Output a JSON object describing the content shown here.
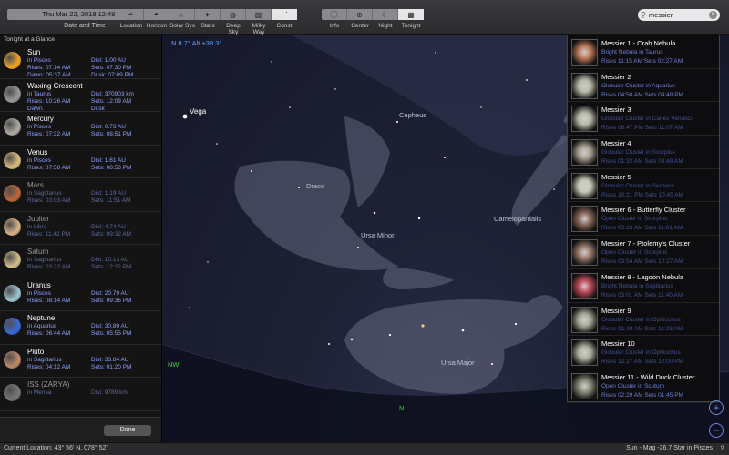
{
  "toolbar": {
    "date_value": "Thu Mar 22, 2018  12:48 PM",
    "date_label": "Date and Time",
    "view_buttons": [
      {
        "label": "Location",
        "icon": "location-pin-icon"
      },
      {
        "label": "Horizon",
        "icon": "horizon-icon"
      },
      {
        "label": "Solar Sys",
        "icon": "saturn-icon"
      },
      {
        "label": "Stars",
        "icon": "stars-icon"
      },
      {
        "label": "Deep Sky",
        "icon": "galaxy-icon"
      },
      {
        "label": "Milky Way",
        "icon": "milky-way-icon"
      },
      {
        "label": "Const",
        "icon": "constellation-icon"
      }
    ],
    "action_buttons": [
      {
        "label": "Info",
        "icon": "info-icon"
      },
      {
        "label": "Center",
        "icon": "target-icon"
      },
      {
        "label": "Night",
        "icon": "moon-icon"
      },
      {
        "label": "Tonight",
        "icon": "tonight-icon"
      }
    ],
    "search_value": "messier"
  },
  "left_panel": {
    "title": "Tonight at a Glance",
    "done_label": "Done",
    "items": [
      {
        "name": "Sun",
        "l1": "in Pisces",
        "l2": "Rises: 07:14 AM",
        "l3": "Dawn: 05:37 AM",
        "r1": "Dist: 1.00 AU",
        "r2": "Sets: 07:30 PM",
        "r3": "Dusk: 07:09 PM",
        "color": "#f5a623",
        "dim": false
      },
      {
        "name": "Waxing Crescent",
        "l1": "in Taurus",
        "l2": "Rises: 10:26 AM",
        "l3": "Dawn",
        "r1": "Dist: 370903 km",
        "r2": "Sets: 12:09 AM",
        "r3": "Dusk",
        "color": "#9a9a9a",
        "dim": false
      },
      {
        "name": "Mercury",
        "l1": "in Pisces",
        "l2": "Rises: 07:32 AM",
        "l3": "",
        "r1": "Dist: 0.73 AU",
        "r2": "Sets: 08:51 PM",
        "r3": "",
        "color": "#b0aca4",
        "dim": false
      },
      {
        "name": "Venus",
        "l1": "in Pisces",
        "l2": "Rises: 07:58 AM",
        "l3": "",
        "r1": "Dist: 1.61 AU",
        "r2": "Sets: 08:58 PM",
        "r3": "",
        "color": "#e0c080",
        "dim": false
      },
      {
        "name": "Mars",
        "l1": "in Sagittarius",
        "l2": "Rises: 03:03 AM",
        "l3": "",
        "r1": "Dist: 1.19 AU",
        "r2": "Sets: 11:51 AM",
        "r3": "",
        "color": "#c0653a",
        "dim": true
      },
      {
        "name": "Jupiter",
        "l1": "in Libra",
        "l2": "Rises: 11:42 PM",
        "l3": "",
        "r1": "Dist: 4.74 AU",
        "r2": "Sets: 09:32 AM",
        "r3": "",
        "color": "#d8b488",
        "dim": true
      },
      {
        "name": "Saturn",
        "l1": "in Sagittarius",
        "l2": "Rises: 03:22 AM",
        "l3": "",
        "r1": "Dist: 10.13 AU",
        "r2": "Sets: 12:22 PM",
        "r3": "",
        "color": "#d6c08a",
        "dim": true
      },
      {
        "name": "Uranus",
        "l1": "in Pisces",
        "l2": "Rises: 08:14 AM",
        "l3": "",
        "r1": "Dist: 20.79 AU",
        "r2": "Sets: 09:36 PM",
        "r3": "",
        "color": "#9ec6d0",
        "dim": false
      },
      {
        "name": "Neptune",
        "l1": "in Aquarius",
        "l2": "Rises: 06:44 AM",
        "l3": "",
        "r1": "Dist: 30.89 AU",
        "r2": "Sets: 05:55 PM",
        "r3": "",
        "color": "#3a6ad8",
        "dim": false
      },
      {
        "name": "Pluto",
        "l1": "in Sagittarius",
        "l2": "Rises: 04:12 AM",
        "l3": "",
        "r1": "Dist: 33.84 AU",
        "r2": "Sets: 01:20 PM",
        "r3": "",
        "color": "#c08a6a",
        "dim": false
      },
      {
        "name": "ISS (ZARYA)",
        "l1": "in Mensa",
        "l2": "",
        "l3": "",
        "r1": "Dist: 9789 km",
        "r2": "",
        "r3": "",
        "color": "#777777",
        "dim": true
      }
    ]
  },
  "sky": {
    "readout": "N 8.7° Alt +38.3°",
    "labels": [
      "Vega",
      "Cepheus",
      "Draco",
      "Ursa Minor",
      "Camelopardalis",
      "Ursa Major"
    ],
    "compass": [
      "NW",
      "N"
    ]
  },
  "results": [
    {
      "name": "Messier 1 - Crab Nebula",
      "type": "Bright Nebula in Taurus",
      "times": "Rises 11:15 AM  Sets 02:27 AM",
      "color": "#c07a5a",
      "dim": false
    },
    {
      "name": "Messier 2",
      "type": "Globular Cluster in Aquarius",
      "times": "Rises 04:50 AM  Sets 04:48 PM",
      "color": "#b8b8a8",
      "dim": false
    },
    {
      "name": "Messier 3",
      "type": "Globular Cluster in Canes Venatici",
      "times": "Rises 06:47 PM  Sets 11:07 AM",
      "color": "#b8b8a8",
      "dim": true
    },
    {
      "name": "Messier 4",
      "type": "Globular Cluster in Scorpius",
      "times": "Rises 01:32 AM  Sets 09:48 AM",
      "color": "#a8a090",
      "dim": true
    },
    {
      "name": "Messier 5",
      "type": "Globular Cluster in Serpens",
      "times": "Rises 10:21 PM  Sets 10:45 AM",
      "color": "#c8c8b8",
      "dim": true
    },
    {
      "name": "Messier 6 - Butterfly Cluster",
      "type": "Open Cluster in Scorpius",
      "times": "Rises 03:23 AM  Sets 11:01 AM",
      "color": "#8a6a5a",
      "dim": true
    },
    {
      "name": "Messier 7 - Ptolemy's Cluster",
      "type": "Open Cluster in Scorpius",
      "times": "Rises 03:54 AM  Sets 10:27 AM",
      "color": "#9a7a6a",
      "dim": true
    },
    {
      "name": "Messier 8 - Lagoon Nebula",
      "type": "Bright Nebula in Sagittarius",
      "times": "Rises 03:01 AM  Sets 11:40 AM",
      "color": "#c04a5a",
      "dim": true
    },
    {
      "name": "Messier 9",
      "type": "Globular Cluster in Ophiuchus",
      "times": "Rises 01:48 AM  Sets 11:23 AM",
      "color": "#a8a898",
      "dim": true
    },
    {
      "name": "Messier 10",
      "type": "Globular Cluster in Ophiuchus",
      "times": "Rises 12:27 AM  Sets 12:00 PM",
      "color": "#b0b0a0",
      "dim": true
    },
    {
      "name": "Messier 11 - Wild Duck Cluster",
      "type": "Open Cluster in Scutum",
      "times": "Rises 02:29 AM  Sets 01:45 PM",
      "color": "#8a8a7a",
      "dim": false
    }
  ],
  "status": {
    "location": "Current Location: 43° 56' N, 078° 52'",
    "selection": "Sun - Mag -26.7 Star in Pisces"
  }
}
